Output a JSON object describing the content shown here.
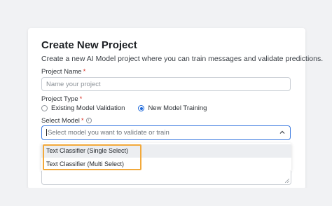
{
  "dialog": {
    "title": "Create New Project",
    "subtitle": "Create a new AI Model project where you can train messages and validate predictions."
  },
  "project_name": {
    "label": "Project Name",
    "required_mark": "*",
    "placeholder": "Name your project"
  },
  "project_type": {
    "label": "Project Type",
    "required_mark": "*",
    "options": [
      {
        "label": "Existing Model Validation",
        "selected": false
      },
      {
        "label": "New Model Training",
        "selected": true
      }
    ]
  },
  "select_model": {
    "label": "Select Model",
    "required_mark": "*",
    "info_icon": "i",
    "placeholder": "Select model you want to validate or train",
    "options": [
      {
        "label": "Text Classifier (Single Select)"
      },
      {
        "label": "Text Classifier (Multi Select)"
      }
    ]
  },
  "colors": {
    "accent": "#1a66d9",
    "highlight": "#f2a93b",
    "required": "#d93025"
  }
}
